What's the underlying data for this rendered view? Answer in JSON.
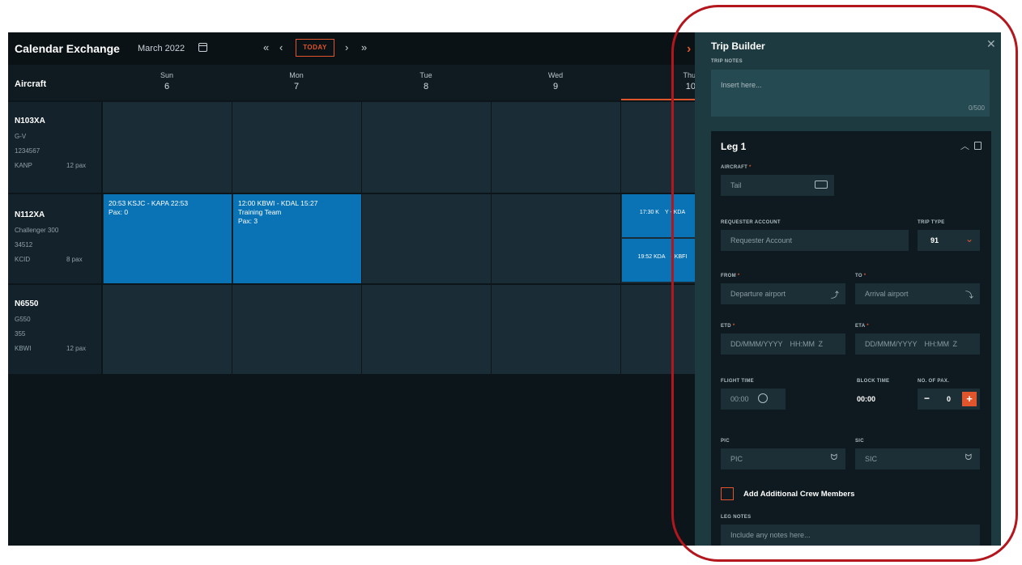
{
  "calendar": {
    "app_title": "Calendar Exchange",
    "month": "March 2022",
    "nav": {
      "first": "«",
      "prev": "‹",
      "today": "TODAY",
      "next": "›",
      "last": "»"
    },
    "aircraft_header": "Aircraft",
    "days": [
      {
        "name": "Sun",
        "num": "6"
      },
      {
        "name": "Mon",
        "num": "7"
      },
      {
        "name": "Tue",
        "num": "8"
      },
      {
        "name": "Wed",
        "num": "9"
      },
      {
        "name": "Thu",
        "num": "10"
      }
    ],
    "aircraft": [
      {
        "tail": "N103XA",
        "type": "G-V",
        "serial": "1234567",
        "base": "KANP",
        "pax": "12 pax"
      },
      {
        "tail": "N112XA",
        "type": "Challenger 300",
        "serial": "34512",
        "base": "KCID",
        "pax": "8 pax"
      },
      {
        "tail": "N6550",
        "type": "G550",
        "serial": "355",
        "base": "KBWI",
        "pax": "12 pax"
      }
    ],
    "events": [
      {
        "title": "20:53 KSJC - KAPA 22:53",
        "line2": "Pax: 0",
        "line3": ""
      },
      {
        "title": "12:00 KBWI - KDAL 15:27",
        "line2": "Training Team",
        "line3": "Pax: 3"
      }
    ],
    "thu_events": [
      "17:30 K  Y - KDA",
      "19:52 KDA  - KBFI"
    ]
  },
  "trip_builder": {
    "title": "Trip Builder",
    "trip_notes_label": "TRIP NOTES",
    "trip_notes_placeholder": "Insert here...",
    "trip_notes_count": "0/500",
    "leg": {
      "title": "Leg 1",
      "aircraft_label": "AIRCRAFT",
      "aircraft_placeholder": "Tail",
      "requester_label": "REQUESTER ACCOUNT",
      "requester_placeholder": "Requester Account",
      "trip_type_label": "TRIP TYPE",
      "trip_type_value": "91",
      "from_label": "FROM",
      "from_placeholder": "Departure airport",
      "to_label": "TO",
      "to_placeholder": "Arrival airport",
      "etd_label": "ETD",
      "etd_placeholder": "DD/MMM/YYYY HH:MM Z",
      "eta_label": "ETA",
      "eta_placeholder": "DD/MMM/YYYY HH:MM Z",
      "flight_time_label": "FLIGHT TIME",
      "flight_time_placeholder": "00:00",
      "block_time_label": "BLOCK TIME",
      "block_time_value": "00:00",
      "pax_label": "NO. OF PAX.",
      "pax_value": "0",
      "pic_label": "PIC",
      "pic_placeholder": "PIC",
      "sic_label": "SIC",
      "sic_placeholder": "SIC",
      "add_crew_label": "Add Additional Crew Members",
      "leg_notes_label": "LEG NOTES",
      "leg_notes_placeholder": "Include any notes here..."
    },
    "required_mark": "*"
  },
  "colors": {
    "accent": "#e0552b",
    "event_blue": "#0a73b5",
    "panel_bg": "#1d3a40",
    "annotation_ring": "#b3161c"
  }
}
